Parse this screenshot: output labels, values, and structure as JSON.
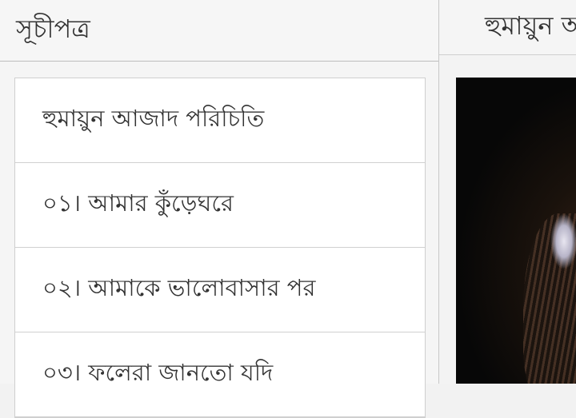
{
  "drawer": {
    "title": "সূচীপত্র",
    "items": [
      {
        "label": "হুমায়ুন আজাদ পরিচিতি"
      },
      {
        "label": "০১। আমার কুঁড়েঘরে"
      },
      {
        "label": "০২। আমাকে ভালোবাসার পর"
      },
      {
        "label": "০৩। ফলেরা জানতো যদি"
      }
    ]
  },
  "appbar": {
    "title": "হুমায়ুন আজাদ",
    "menu_icon": "hamburger-menu-icon"
  },
  "content": {
    "image": "author-portrait"
  }
}
